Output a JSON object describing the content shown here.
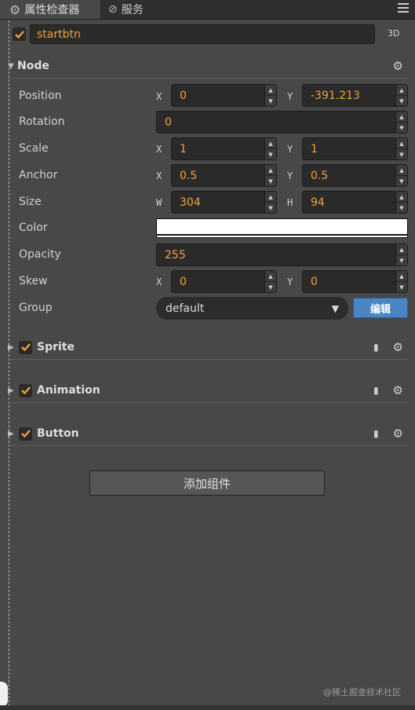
{
  "tabs": [
    {
      "label": "属性检查器",
      "icon": "gear-icon"
    },
    {
      "label": "服务",
      "icon": "link-icon"
    }
  ],
  "node_name": "startbtn",
  "mode_label": "3D",
  "node_section": {
    "title": "Node"
  },
  "props": {
    "position": {
      "label": "Position",
      "x_axis": "X",
      "x": "0",
      "y_axis": "Y",
      "y": "-391.213"
    },
    "rotation": {
      "label": "Rotation",
      "value": "0"
    },
    "scale": {
      "label": "Scale",
      "x_axis": "X",
      "x": "1",
      "y_axis": "Y",
      "y": "1"
    },
    "anchor": {
      "label": "Anchor",
      "x_axis": "X",
      "x": "0.5",
      "y_axis": "Y",
      "y": "0.5"
    },
    "size": {
      "label": "Size",
      "w_axis": "W",
      "w": "304",
      "h_axis": "H",
      "h": "94"
    },
    "color": {
      "label": "Color",
      "value": "#ffffff"
    },
    "opacity": {
      "label": "Opacity",
      "value": "255"
    },
    "skew": {
      "label": "Skew",
      "x_axis": "X",
      "x": "0",
      "y_axis": "Y",
      "y": "0"
    },
    "group": {
      "label": "Group",
      "value": "default",
      "edit_label": "编辑"
    }
  },
  "components": [
    {
      "name": "Sprite"
    },
    {
      "name": "Animation"
    },
    {
      "name": "Button"
    }
  ],
  "add_component_label": "添加组件",
  "watermark": "@稀土掘金技术社区",
  "colors": {
    "accent_value": "#f0a03c",
    "check": "#f0a03c",
    "edit_button": "#4a86c4"
  }
}
